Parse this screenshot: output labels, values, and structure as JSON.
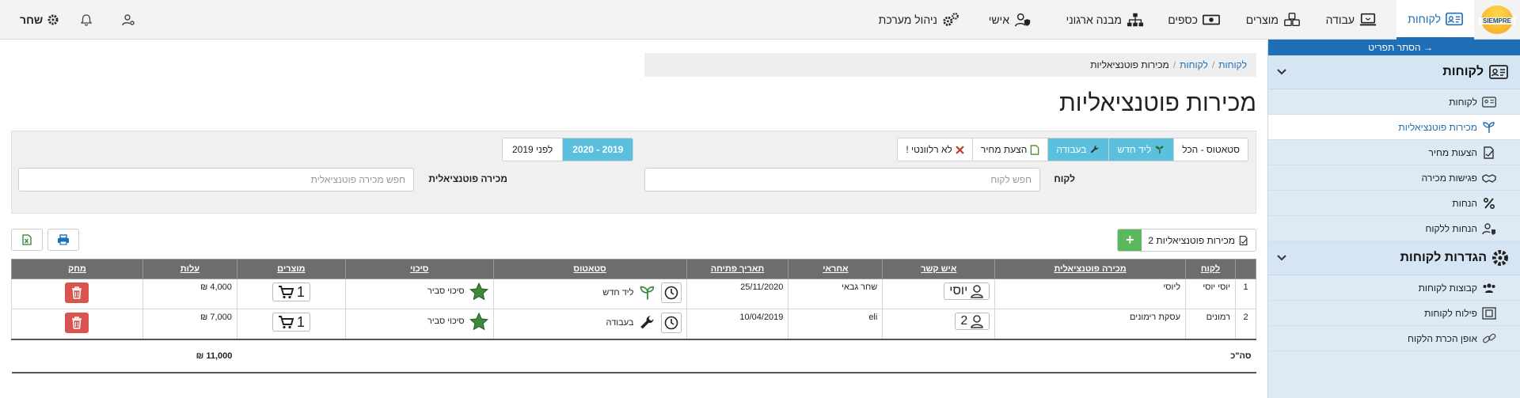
{
  "topbar": {
    "logo_text": "SIEMPRE",
    "nav": [
      {
        "label": "לקוחות",
        "icon": "id-card-icon",
        "active": true
      },
      {
        "label": "עבודה",
        "icon": "laptop-icon",
        "active": false
      },
      {
        "label": "מוצרים",
        "icon": "boxes-icon",
        "active": false
      },
      {
        "label": "כספים",
        "icon": "money-bill-icon",
        "active": false
      },
      {
        "label": "מבנה ארגוני",
        "icon": "sitemap-icon",
        "active": false
      },
      {
        "label": "אישי",
        "icon": "user-shield-icon",
        "active": false
      },
      {
        "label": "ניהול מערכת",
        "icon": "gears-icon",
        "active": false
      }
    ],
    "user_name": "שחר",
    "icons": [
      "gear-icon",
      "bell-icon",
      "user-settings-icon"
    ]
  },
  "sidebar": {
    "hide_menu": "→ הסתר תפריט",
    "section1_title": "לקוחות",
    "section1_items": [
      {
        "label": "לקוחות",
        "icon": "id-card-icon",
        "active": false
      },
      {
        "label": "מכירות פוטנציאליות",
        "icon": "seedling-icon",
        "active": true
      },
      {
        "label": "הצעות מחיר",
        "icon": "file-signature-icon",
        "active": false
      },
      {
        "label": "פגישות מכירה",
        "icon": "handshake-icon",
        "active": false
      },
      {
        "label": "הנחות",
        "icon": "percent-icon",
        "active": false
      },
      {
        "label": "הנחות ללקוח",
        "icon": "user-tag-icon",
        "active": false
      }
    ],
    "section2_title": "הגדרות לקוחות",
    "section2_items": [
      {
        "label": "קבוצות לקוחות",
        "icon": "users-icon"
      },
      {
        "label": "פילוח לקוחות",
        "icon": "segment-icon"
      },
      {
        "label": "אופן הכרת הלקוח",
        "icon": "link-icon"
      }
    ]
  },
  "breadcrumb": {
    "items": [
      "לקוחות",
      "לקוחות"
    ],
    "current": "מכירות פוטנציאליות"
  },
  "page_title": "מכירות פוטנציאליות",
  "filters": {
    "status_buttons": [
      {
        "label": "סטאטוס - הכל",
        "on": false
      },
      {
        "label": "ליד חדש",
        "on": true
      },
      {
        "label": "בעבודה",
        "on": true
      },
      {
        "label": "הצעת מחיר",
        "on": false
      },
      {
        "label": "לא רלוונטי !",
        "on": false
      }
    ],
    "year_buttons": [
      {
        "label": "2019 - 2020",
        "on": true
      },
      {
        "label": "לפני 2019",
        "on": false
      }
    ],
    "customer_label": "לקוח",
    "customer_placeholder": "חפש לקוח",
    "opportunity_label": "מכירה פוטנציאלית",
    "opportunity_placeholder": "חפש מכירה פוטנציאלית"
  },
  "list_header": {
    "label": "מכירות פוטנציאליות 2",
    "add": "+"
  },
  "table": {
    "columns": [
      "",
      "לקוח",
      "מכירה פוטנציאלית",
      "איש קשר",
      "אחראי",
      "תאריך פתיחה",
      "סטאטוס",
      "סיכוי",
      "מוצרים",
      "עלות",
      "מחק"
    ],
    "rows": [
      {
        "num": "1",
        "customer": "יוסי יוסי",
        "opportunity": "ליוסי",
        "contact": "יוסי",
        "owner": "שחר גבאי",
        "opened": "25/11/2020",
        "status": "ליד חדש",
        "chance": "סיכוי סביר",
        "products": "1",
        "cost": "4,000 ₪"
      },
      {
        "num": "2",
        "customer": "רמונים",
        "opportunity": "עסקת רימונים",
        "contact": "2",
        "owner": "eli",
        "opened": "10/04/2019",
        "status": "בעבודה",
        "chance": "סיכוי סביר",
        "products": "1",
        "cost": "7,000 ₪"
      }
    ],
    "total_label": "סה\"כ",
    "total_value": "11,000 ₪"
  },
  "colors": {
    "accent": "#1e6fb5",
    "sidebar_bg": "#ddeaf6",
    "info": "#5bc0de",
    "success": "#5cb85c",
    "danger": "#d9534f",
    "table_header": "#6d6d6d",
    "star": "#3c8a3c"
  }
}
